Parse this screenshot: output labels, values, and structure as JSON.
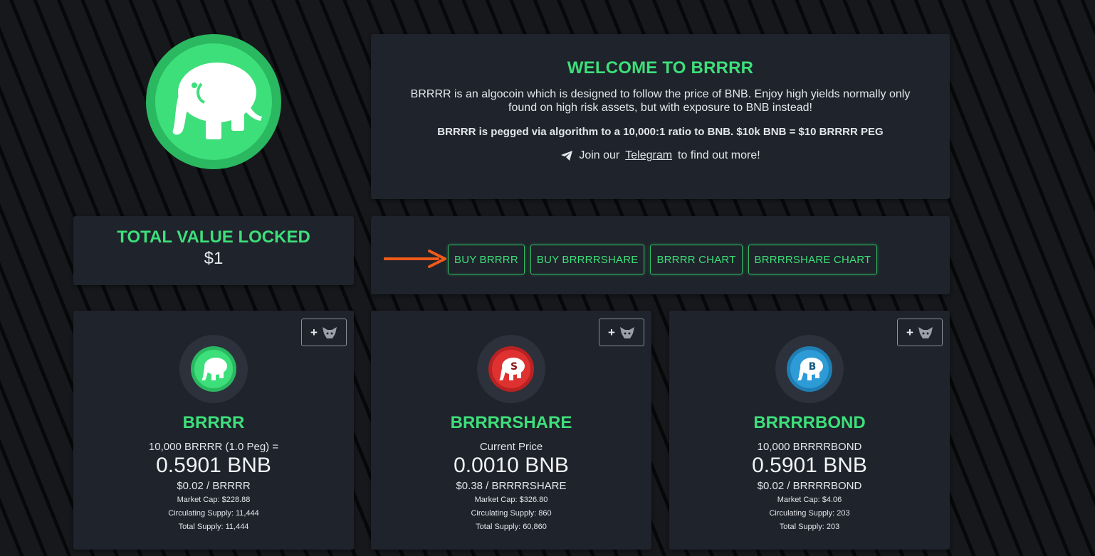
{
  "welcome": {
    "title": "WELCOME TO BRRRR",
    "description": "BRRRR is an algocoin which is designed to follow the price of BNB. Enjoy high yields normally only found on high risk assets, but with exposure to BNB instead!",
    "peg_text": "BRRRR is pegged via algorithm to a 10,000:1 ratio to BNB. $10k BNB = $10 BRRRR PEG",
    "join_prefix": "Join our",
    "join_link": "Telegram",
    "join_suffix": "to find out more!"
  },
  "tvl": {
    "label": "TOTAL VALUE LOCKED",
    "value": "$1"
  },
  "buttons": [
    {
      "label": "BUY BRRRR"
    },
    {
      "label": "BUY BRRRRSHARE"
    },
    {
      "label": "BRRRR CHART"
    },
    {
      "label": "BRRRRSHARE CHART"
    }
  ],
  "cards": [
    {
      "add_label": "+",
      "name": "BRRRR",
      "icon_letter": "",
      "icon_color": "#2ecc6a",
      "line1": "10,000 BRRRR (1.0 Peg) =",
      "price": "0.5901 BNB",
      "usd": "$0.02 / BRRRR",
      "market_cap": "Market Cap: $228.88",
      "circulating": "Circulating Supply: 11,444",
      "total": "Total Supply: 11,444"
    },
    {
      "add_label": "+",
      "name": "BRRRRSHARE",
      "icon_letter": "S",
      "icon_color": "#e03131",
      "line1": "Current Price",
      "price": "0.0010 BNB",
      "usd": "$0.38 / BRRRRSHARE",
      "market_cap": "Market Cap: $326.80",
      "circulating": "Circulating Supply: 860",
      "total": "Total Supply: 60,860"
    },
    {
      "add_label": "+",
      "name": "BRRRRBOND",
      "icon_letter": "B",
      "icon_color": "#2d9bd6",
      "line1": "10,000 BRRRRBOND",
      "price": "0.5901 BNB",
      "usd": "$0.02 / BRRRRBOND",
      "market_cap": "Market Cap: $4.06",
      "circulating": "Circulating Supply: 203",
      "total": "Total Supply: 203"
    }
  ],
  "colors": {
    "accent_green": "#3ddf7a",
    "panel_bg": "#1f232b",
    "arrow": "#f05a1a"
  },
  "icons": [
    "elephant-logo-icon",
    "telegram-icon",
    "arrow-right-icon",
    "metamask-fox-icon"
  ]
}
